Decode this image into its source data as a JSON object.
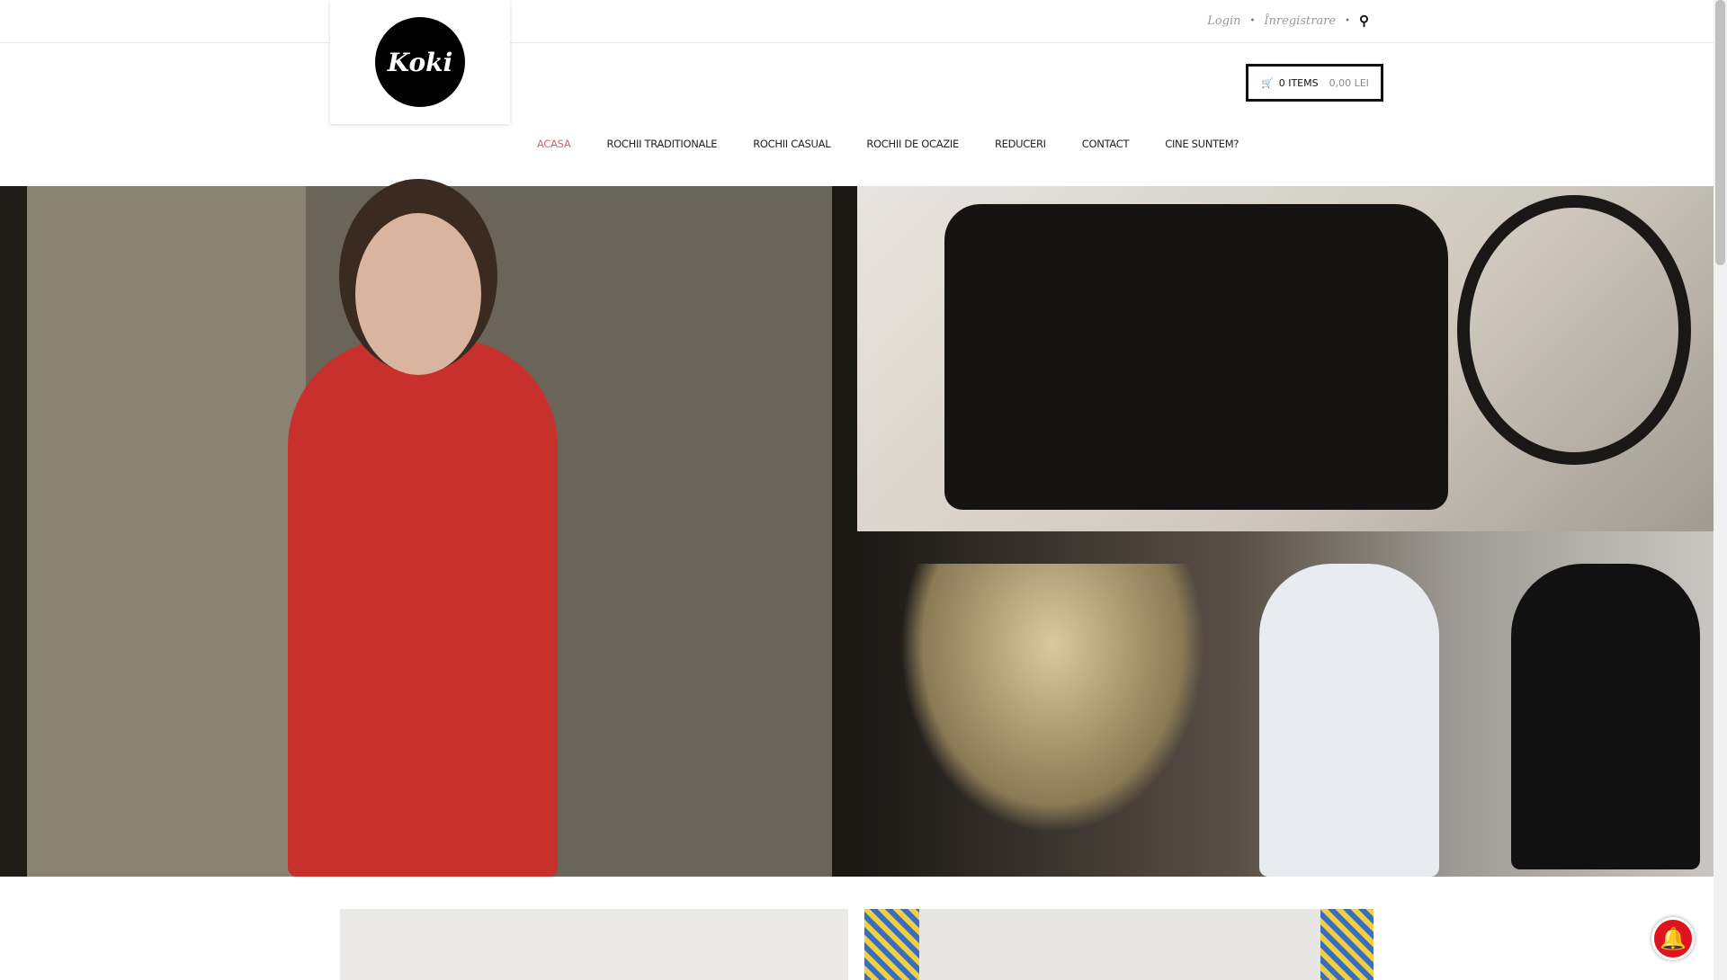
{
  "topbar": {
    "login": "Login",
    "register": "Înregistrare",
    "separator": "•"
  },
  "logo": {
    "text": "Koki"
  },
  "cart": {
    "items": "0 ITEMS",
    "total": "0,00 LEI"
  },
  "nav": {
    "items": [
      "ACASA",
      "ROCHII TRADITIONALE",
      "ROCHII CASUAL",
      "ROCHII DE OCAZIE",
      "REDUCERI",
      "CONTACT",
      "CINE SUNTEM?"
    ]
  },
  "colors": {
    "accent": "#e0606a",
    "notification": "#e0131e"
  }
}
